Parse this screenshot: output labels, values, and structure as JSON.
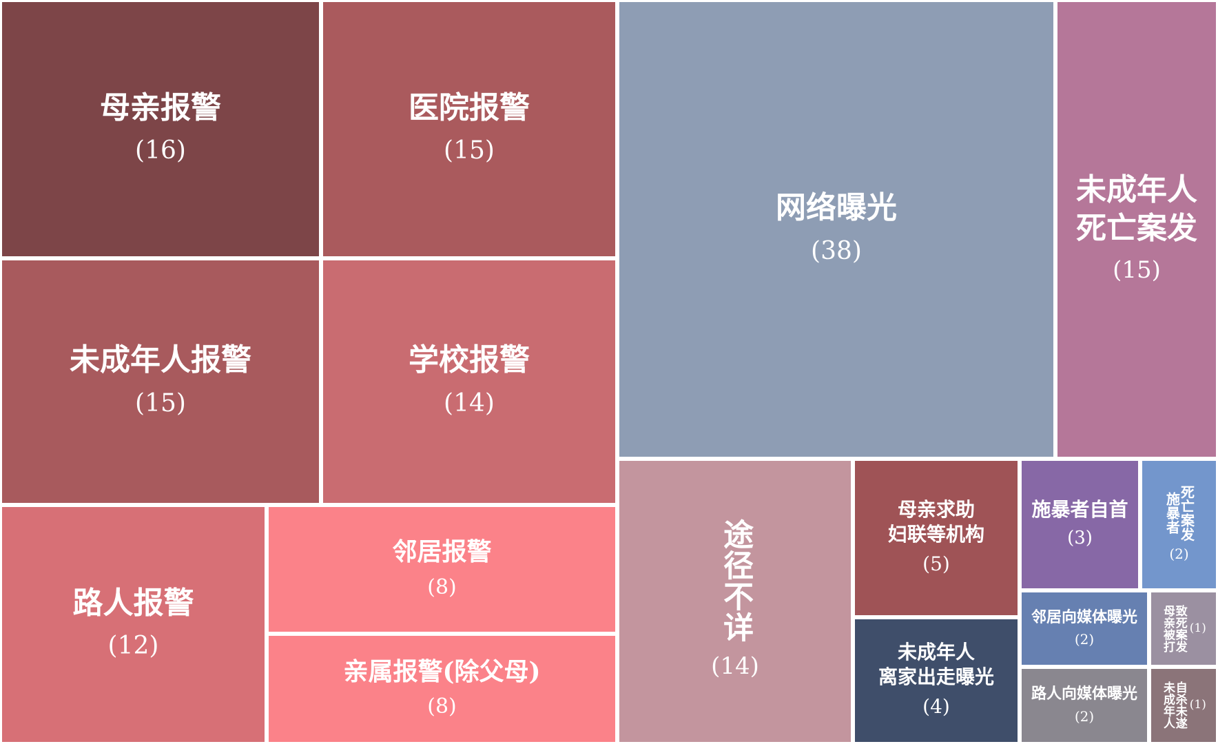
{
  "chart_data": {
    "type": "treemap",
    "title": "",
    "nodes": [
      {
        "label": "母亲报警",
        "value": 16,
        "value_text": "(16)",
        "color": "#7d4548"
      },
      {
        "label": "医院报警",
        "value": 15,
        "value_text": "(15)",
        "color": "#aa5a5d"
      },
      {
        "label": "未成年人报警",
        "value": 15,
        "value_text": "(15)",
        "color": "#a85a5d"
      },
      {
        "label": "学校报警",
        "value": 14,
        "value_text": "(14)",
        "color": "#c96c71"
      },
      {
        "label": "路人报警",
        "value": 12,
        "value_text": "(12)",
        "color": "#d77076"
      },
      {
        "label": "邻居报警",
        "value": 8,
        "value_text": "(8)",
        "color": "#fb8289"
      },
      {
        "label": "亲属报警(除父母)",
        "value": 8,
        "value_text": "(8)",
        "color": "#fb8289"
      },
      {
        "label": "网络曝光",
        "value": 38,
        "value_text": "(38)",
        "color": "#8e9db4"
      },
      {
        "label": "未成年人\n死亡案发",
        "value": 15,
        "value_text": "(15)",
        "color": "#b57799"
      },
      {
        "label": "途径不详",
        "value": 14,
        "value_text": "(14)",
        "color": "#c3959e"
      },
      {
        "label": "母亲求助\n妇联等机构",
        "value": 5,
        "value_text": "(5)",
        "color": "#9f5356"
      },
      {
        "label": "未成年人\n离家出走曝光",
        "value": 4,
        "value_text": "(4)",
        "color": "#3f4e6a"
      },
      {
        "label": "施暴者自首",
        "value": 3,
        "value_text": "(3)",
        "color": "#8768a6"
      },
      {
        "label": "死亡案发\n施暴者",
        "value": 2,
        "value_text": "(2)",
        "color": "#7396cc"
      },
      {
        "label": "邻居向媒体曝光",
        "value": 2,
        "value_text": "(2)",
        "color": "#6680b1"
      },
      {
        "label": "路人向媒体曝光",
        "value": 2,
        "value_text": "(2)",
        "color": "#8a878f"
      },
      {
        "label": "致死案发\n母亲被打",
        "value": 1,
        "value_text": "(1)",
        "color": "#9b90a1"
      },
      {
        "label": "自杀未遂\n未成年人",
        "value": 1,
        "value_text": "(1)",
        "color": "#8b7479"
      }
    ]
  }
}
